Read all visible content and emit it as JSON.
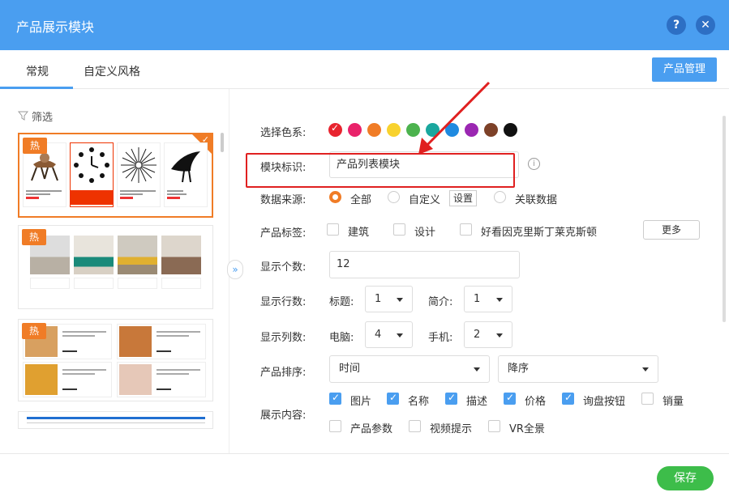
{
  "dialog": {
    "title": "产品展示模块",
    "help_glyph": "?",
    "close_glyph": "✕"
  },
  "tabs": {
    "general": "常规",
    "custom_style": "自定义风格",
    "product_manage_btn": "产品管理"
  },
  "left_panel": {
    "filter_label": "筛选",
    "hot_badge": "热",
    "collapse_glyph": "»"
  },
  "form": {
    "color_label": "选择色系:",
    "colors": [
      "#e8242f",
      "#e9226a",
      "#f07c26",
      "#f8d22e",
      "#4cb34e",
      "#1aa79e",
      "#1f8ae0",
      "#9b27b2",
      "#7d4128",
      "#111111"
    ],
    "module_id_label": "模块标识:",
    "module_id_value": "产品列表模块",
    "info_glyph": "i",
    "data_source_label": "数据来源:",
    "data_source_all": "全部",
    "data_source_custom": "自定义",
    "data_source_settings": "设置",
    "data_source_related": "关联数据",
    "tags_label": "产品标签:",
    "tag_1": "建筑",
    "tag_2": "设计",
    "tag_3": "好看因克里斯丁莱克斯顿",
    "more_btn": "更多",
    "count_label": "显示个数:",
    "count_value": "12",
    "rows_label": "显示行数:",
    "rows_title_label": "标题:",
    "rows_title_value": "1",
    "rows_brief_label": "简介:",
    "rows_brief_value": "1",
    "cols_label": "显示列数:",
    "cols_pc_label": "电脑:",
    "cols_pc_value": "4",
    "cols_mobile_label": "手机:",
    "cols_mobile_value": "2",
    "sort_label": "产品排序:",
    "sort_field": "时间",
    "sort_order": "降序",
    "content_label": "展示内容:",
    "content_image": "图片",
    "content_name": "名称",
    "content_desc": "描述",
    "content_price": "价格",
    "content_inquiry": "询盘按钮",
    "content_sales": "销量",
    "content_params": "产品参数",
    "content_video": "视频提示",
    "content_vr": "VR全景"
  },
  "footer": {
    "save_btn": "保存"
  }
}
